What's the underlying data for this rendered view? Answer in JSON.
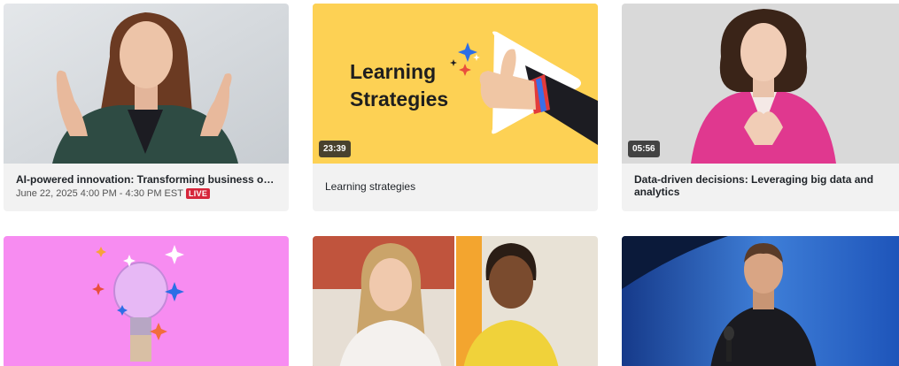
{
  "cards": [
    {
      "title": "AI-powered innovation: Transforming business operat…",
      "date": "June 22, 2025 4:00 PM - 4:30 PM EST",
      "badge": "LIVE"
    },
    {
      "thumb_text_line1": "Learning",
      "thumb_text_line2": "Strategies",
      "duration": "23:39",
      "title": "Learning strategies"
    },
    {
      "duration": "05:56",
      "title": "Data-driven decisions: Leveraging big data and analytics"
    },
    {
      "title": ""
    },
    {
      "title": ""
    },
    {
      "title": ""
    }
  ],
  "colors": {
    "live_badge": "#d6263b",
    "card_info_bg": "#f2f2f2",
    "yellow_thumb": "#fdd154",
    "pink_thumb": "#f78cf1"
  }
}
